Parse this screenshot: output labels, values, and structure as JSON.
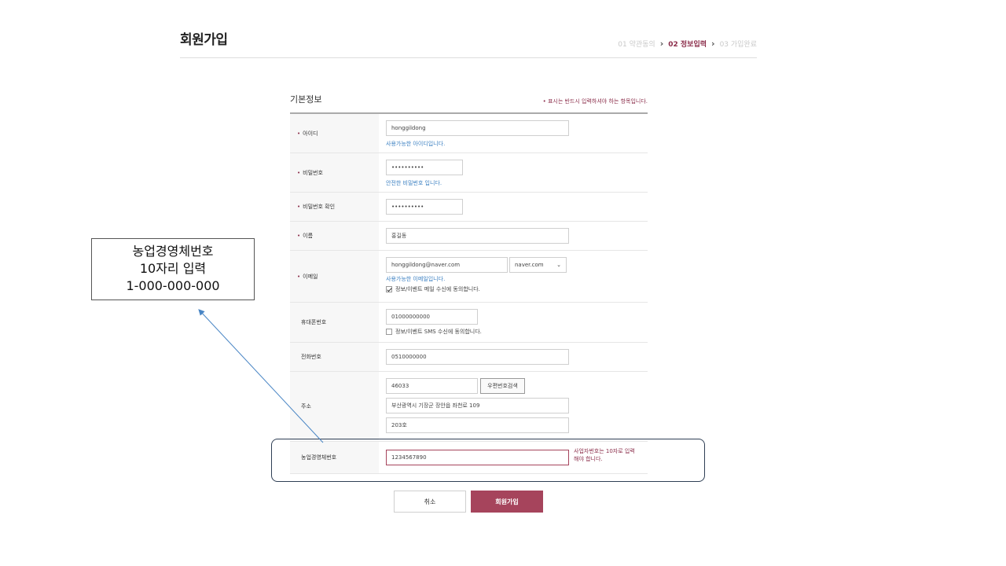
{
  "header": {
    "title": "회원가입",
    "steps": [
      {
        "label": "01 약관동의",
        "active": false
      },
      {
        "label": "02 정보입력",
        "active": true
      },
      {
        "label": "03 가입완료",
        "active": false
      }
    ]
  },
  "section": {
    "title": "기본정보",
    "required_note": "• 표시는 반드시 입력하셔야 하는 항목입니다."
  },
  "form": {
    "id": {
      "label": "아이디",
      "value": "honggildong",
      "hint": "사용가능한 아이디입니다."
    },
    "password": {
      "label": "비밀번호",
      "value": "••••••••••",
      "hint": "안전한 비밀번호 입니다."
    },
    "password_confirm": {
      "label": "비밀번호 확인",
      "value": "••••••••••"
    },
    "name": {
      "label": "이름",
      "value": "홍길동"
    },
    "email": {
      "label": "이메일",
      "value": "honggildong@naver.com",
      "domain": "naver.com",
      "hint": "사용가능한 이메일입니다.",
      "consent": "정보/이벤트 메일 수신에 동의합니다.",
      "consent_checked": true
    },
    "mobile": {
      "label": "휴대폰번호",
      "value": "01000000000",
      "consent": "정보/이벤트 SMS 수신에 동의합니다.",
      "consent_checked": false
    },
    "phone": {
      "label": "전화번호",
      "value": "0510000000"
    },
    "address": {
      "label": "주소",
      "zip": "46033",
      "zip_button": "우편번호검색",
      "line1": "부산광역시 기장군 장안읍 좌천로 109",
      "line2": "203호"
    },
    "farm_id": {
      "label": "농업경영체번호",
      "value": "1234567890",
      "note_line1": "사업자번호는 10자로 입력",
      "note_line2": "해야 합니다."
    }
  },
  "buttons": {
    "cancel": "취소",
    "submit": "회원가입"
  },
  "callout": {
    "line1": "농업경영체번호",
    "line2": "10자리 입력",
    "line3": "1-000-000-000"
  },
  "colors": {
    "accent": "#a6445c",
    "hint": "#3a7fc1",
    "required": "#8b2d4a"
  },
  "required_mark": "•"
}
